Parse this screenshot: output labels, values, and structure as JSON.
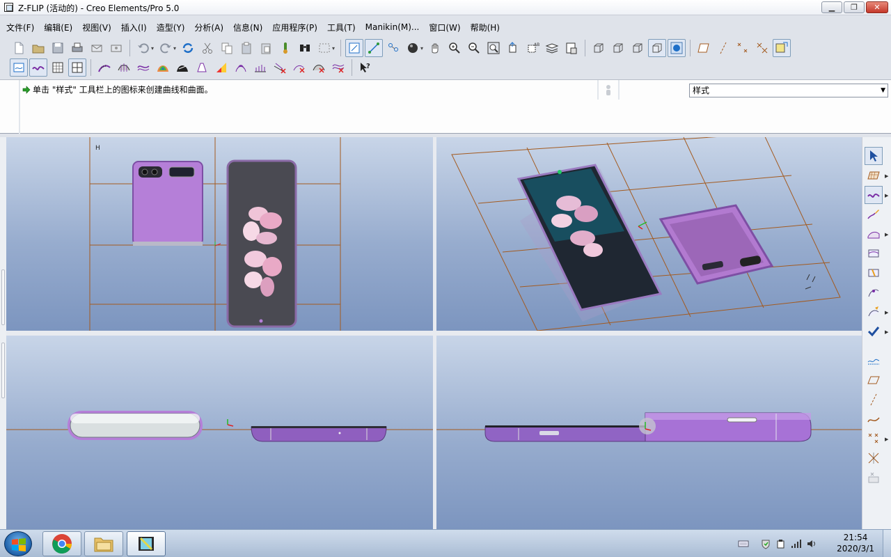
{
  "window": {
    "title": "Z-FLIP (活动的) - Creo Elements/Pro 5.0"
  },
  "window_controls": {
    "minimize": "▁",
    "restore": "❐",
    "close": "✕"
  },
  "menu": [
    "文件(F)",
    "编辑(E)",
    "视图(V)",
    "插入(I)",
    "造型(Y)",
    "分析(A)",
    "信息(N)",
    "应用程序(P)",
    "工具(T)",
    "Manikin(M)...",
    "窗口(W)",
    "帮助(H)"
  ],
  "message": {
    "text": "单击 \"样式\" 工具栏上的图标来创建曲线和曲面。"
  },
  "style_selector": {
    "value": "样式"
  },
  "viewport_labels": {
    "top_left_tag": "H"
  },
  "model": {
    "back_screen_label": "",
    "logo_text": ""
  },
  "taskbar": {
    "time": "21:54",
    "date": "2020/3/1",
    "apps": [
      "start-orb",
      "chrome",
      "file-explorer",
      "creo"
    ]
  },
  "colors": {
    "viewport_top": "#c8d5e8",
    "viewport_bottom": "#7c95bf",
    "phone_purple": "#b57fd8",
    "datum_grid": "#a35a1f",
    "accent_blue": "#1e6fc8"
  }
}
